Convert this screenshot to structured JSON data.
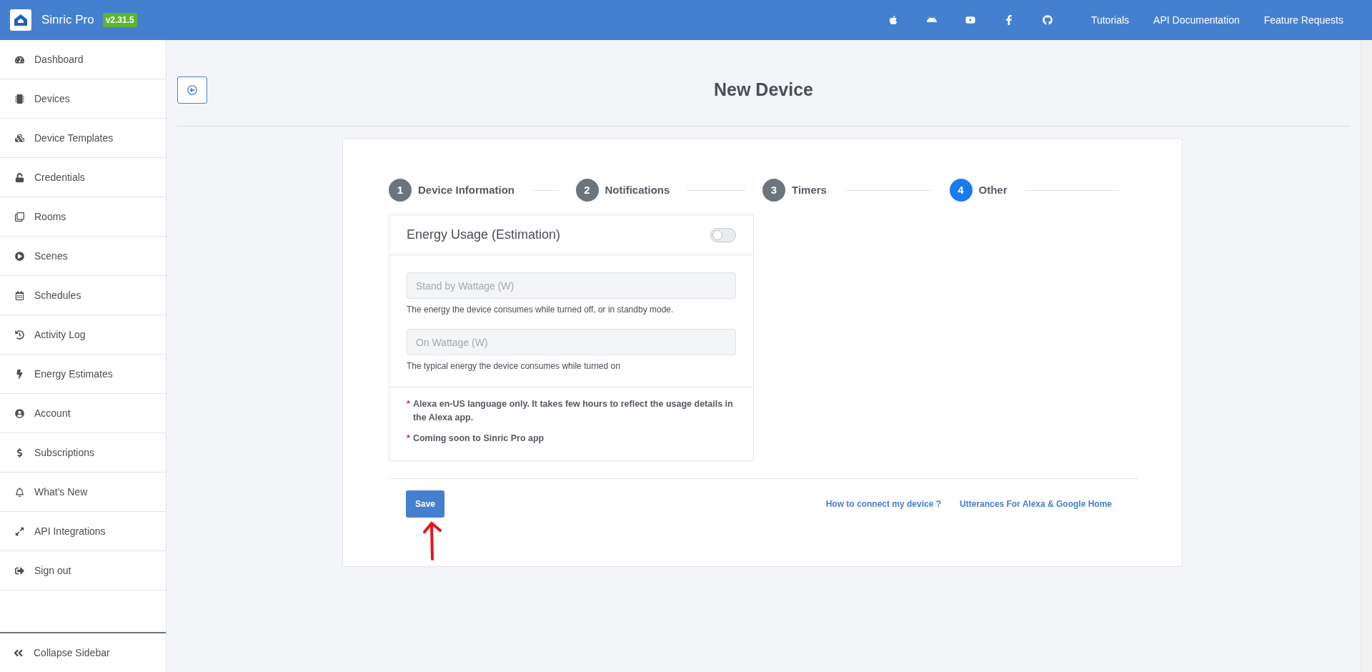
{
  "header": {
    "brand": "Sinric Pro",
    "version": "v2.31.5",
    "links": [
      "Tutorials",
      "API Documentation",
      "Feature Requests"
    ]
  },
  "sidebar": {
    "items": [
      {
        "label": "Dashboard"
      },
      {
        "label": "Devices"
      },
      {
        "label": "Device Templates"
      },
      {
        "label": "Credentials"
      },
      {
        "label": "Rooms"
      },
      {
        "label": "Scenes"
      },
      {
        "label": "Schedules"
      },
      {
        "label": "Activity Log"
      },
      {
        "label": "Energy Estimates"
      },
      {
        "label": "Account"
      },
      {
        "label": "Subscriptions"
      },
      {
        "label": "What's New"
      },
      {
        "label": "API Integrations"
      },
      {
        "label": "Sign out"
      }
    ],
    "collapse": "Collapse Sidebar"
  },
  "page": {
    "title": "New Device"
  },
  "steps": [
    {
      "number": "1",
      "label": "Device Information",
      "selected": false
    },
    {
      "number": "2",
      "label": "Notifications",
      "selected": false
    },
    {
      "number": "3",
      "label": "Timers",
      "selected": false
    },
    {
      "number": "4",
      "label": "Other",
      "selected": true
    }
  ],
  "energy_panel": {
    "title": "Energy Usage (Estimation)",
    "on": false,
    "fields": [
      {
        "placeholder": "Stand by Wattage (W)",
        "help": "The energy the device consumes while turned off, or in standby mode."
      },
      {
        "placeholder": "On Wattage (W)",
        "help": "The typical energy the device consumes while turned on"
      }
    ],
    "notes": [
      {
        "marker": "*",
        "text": "Alexa en-US language only. It takes few hours to reflect the usage details in the Alexa app."
      },
      {
        "marker": "*",
        "text": "Coming soon to Sinric Pro app"
      }
    ]
  },
  "footer": {
    "save": "Save",
    "links": [
      "How to connect my device ?",
      "Utterances For Alexa & Google Home"
    ]
  }
}
